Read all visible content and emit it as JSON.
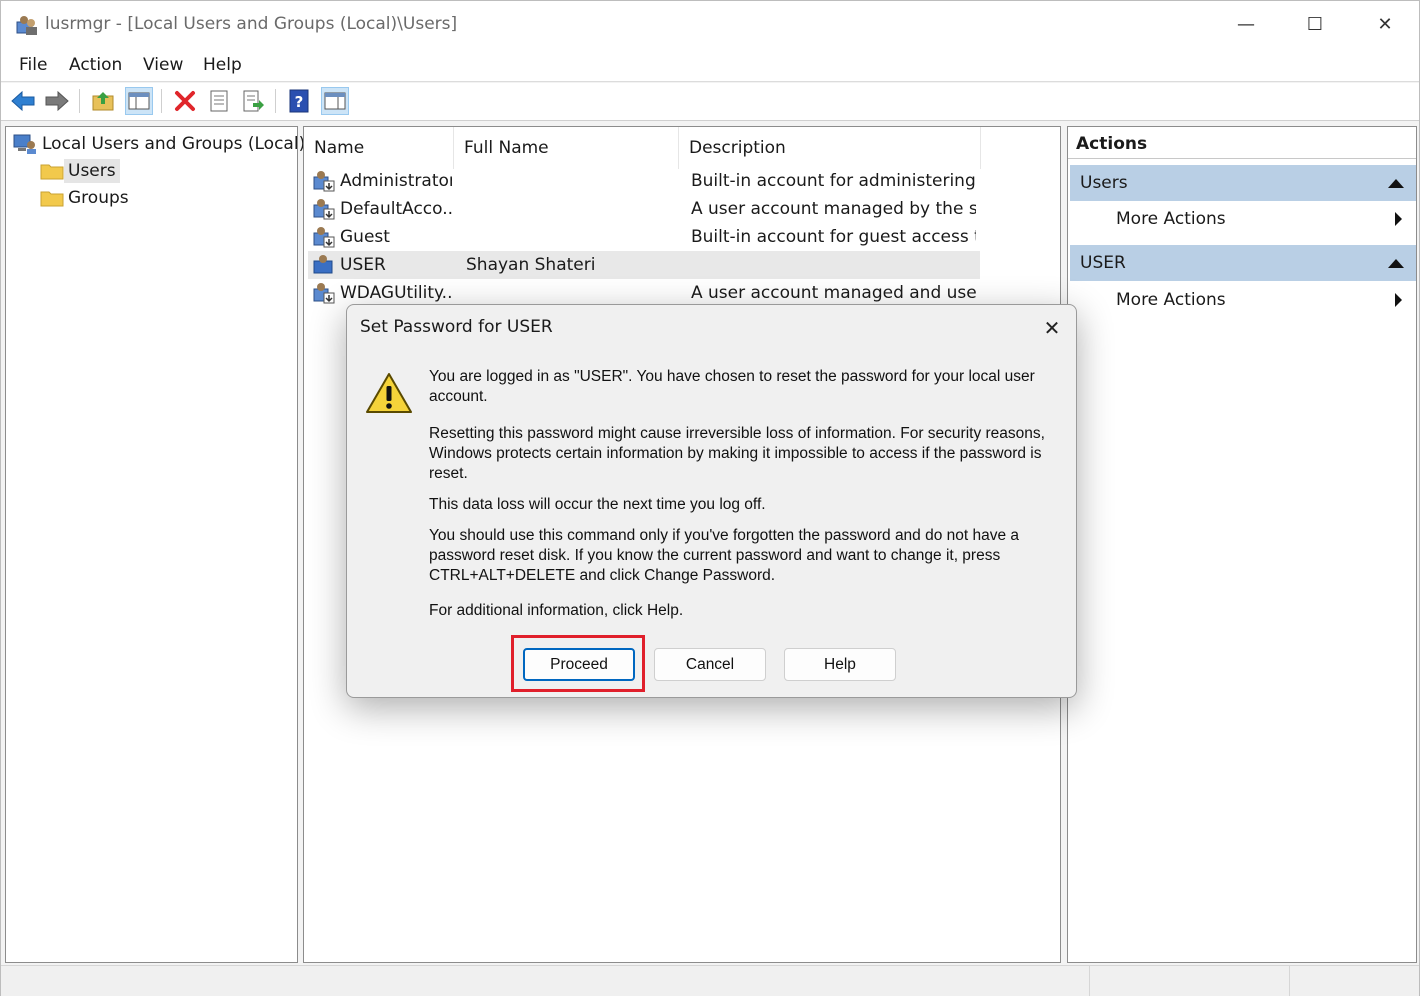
{
  "window": {
    "title": "lusrmgr - [Local Users and Groups (Local)\\Users]",
    "controls": {
      "minimize": "—",
      "maximize": "☐",
      "close": "✕"
    }
  },
  "menu": [
    "File",
    "Action",
    "View",
    "Help"
  ],
  "toolbar": {
    "buttons": [
      "back-arrow-icon",
      "forward-arrow-icon",
      "up-folder-icon",
      "show-hide-console-tree-icon",
      "delete-icon",
      "properties-icon",
      "export-list-icon",
      "help-icon",
      "show-hide-action-pane-icon"
    ]
  },
  "tree": {
    "root": "Local Users and Groups (Local)",
    "children": [
      "Users",
      "Groups"
    ],
    "selected": "Users"
  },
  "list": {
    "columns": [
      "Name",
      "Full Name",
      "Description"
    ],
    "rows": [
      {
        "name": "Administrator",
        "full_name": "",
        "description": "Built-in account for administering ..."
      },
      {
        "name": "DefaultAcco...",
        "full_name": "",
        "description": "A user account managed by the sy..."
      },
      {
        "name": "Guest",
        "full_name": "",
        "description": "Built-in account for guest access t..."
      },
      {
        "name": "USER",
        "full_name": "Shayan Shateri",
        "description": ""
      },
      {
        "name": "WDAGUtility...",
        "full_name": "",
        "description": "A user account managed and used..."
      }
    ],
    "selected_row": "USER"
  },
  "actions": {
    "title": "Actions",
    "groups": [
      {
        "label": "Users",
        "items": [
          "More Actions"
        ]
      },
      {
        "label": "USER",
        "items": [
          "More Actions"
        ]
      }
    ]
  },
  "dialog": {
    "title": "Set Password for USER",
    "paragraphs": [
      "You are logged in as \"USER\". You have chosen to reset the password for your local user account.",
      "Resetting this password might cause irreversible loss of information. For security reasons, Windows protects certain information by making it impossible to access if the password is reset.",
      "This data loss will occur the next time you log off.",
      "You should use this command only if you've forgotten the password and do not have a password reset disk. If you know the current password and want to change it, press CTRL+ALT+DELETE and click Change Password.",
      "For additional information, click Help."
    ],
    "buttons": {
      "proceed": "Proceed",
      "cancel": "Cancel",
      "help": "Help"
    },
    "close_glyph": "✕"
  },
  "colors": {
    "accent": "#0067c0",
    "highlight": "#e01f2b",
    "action_group_bg": "#b9cfe5",
    "selection_bg": "#e8e8e8"
  }
}
